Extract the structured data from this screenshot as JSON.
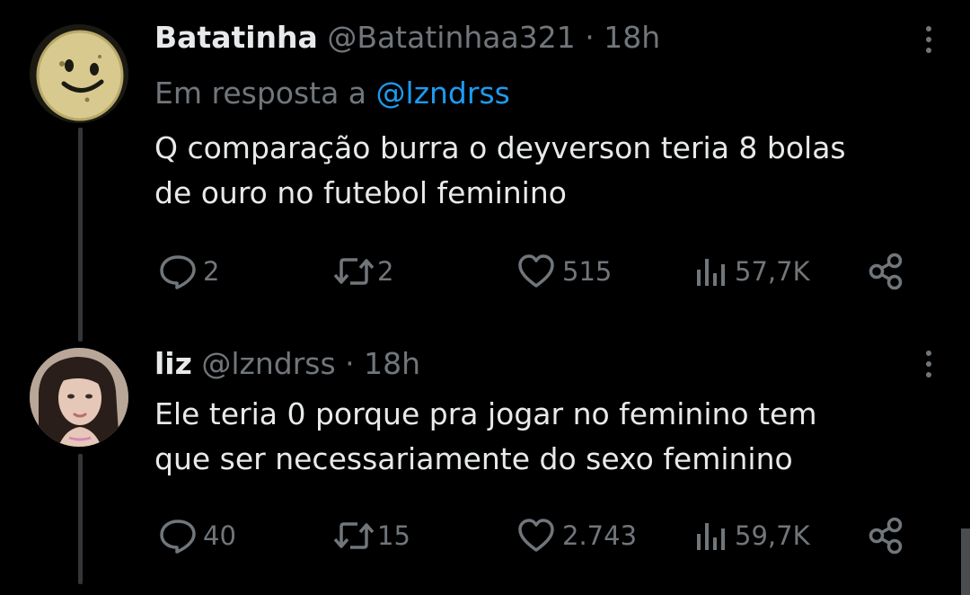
{
  "tweets": [
    {
      "name": "Batatinha",
      "handle": "@Batatinhaa321",
      "dot": "·",
      "time": "18h",
      "reply_prefix": "Em resposta a",
      "reply_mention": "@lzndrss",
      "text_line1": "Q comparação burra o deyverson teria 8 bolas",
      "text_line2": "de ouro no futebol feminino",
      "replies": "2",
      "reposts": "2",
      "likes": "515",
      "views": "57,7K"
    },
    {
      "name": "liz",
      "handle": "@lzndrss",
      "dot": "·",
      "time": "18h",
      "text_line1": "Ele teria 0 porque pra jogar no feminino tem",
      "text_line2": "que ser necessariamente do sexo feminino",
      "replies": "40",
      "reposts": "15",
      "likes": "2.743",
      "views": "59,7K"
    }
  ],
  "icons": {
    "reply": "speech-bubble-icon",
    "repost": "repost-arrows-icon",
    "like": "heart-icon",
    "views": "bar-chart-icon",
    "share": "share-nodes-icon",
    "more": "vertical-ellipsis-icon"
  },
  "colors": {
    "background": "#000000",
    "text": "#e7e9ea",
    "muted": "#71767b",
    "link": "#1d9bf0",
    "thread_line": "#333639"
  }
}
